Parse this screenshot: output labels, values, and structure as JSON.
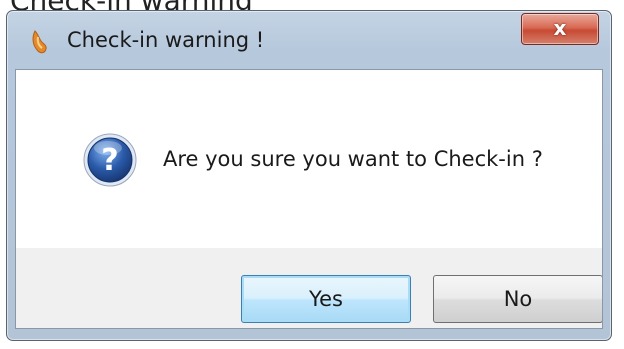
{
  "background_caption": "Check-in warning",
  "dialog": {
    "title": "Check-in warning !",
    "message": "Are you sure you want to Check-in ?",
    "buttons": {
      "yes_label": "Yes",
      "no_label": "No"
    },
    "close_symbol": "x",
    "icons": {
      "title": "app-icon",
      "message": "question-icon",
      "close": "close-icon"
    }
  },
  "colors": {
    "title_bar": "#b6c8dc",
    "close_button": "#c84a33",
    "question_icon": "#2a5aa8",
    "default_button_border": "#3c7fb1"
  }
}
